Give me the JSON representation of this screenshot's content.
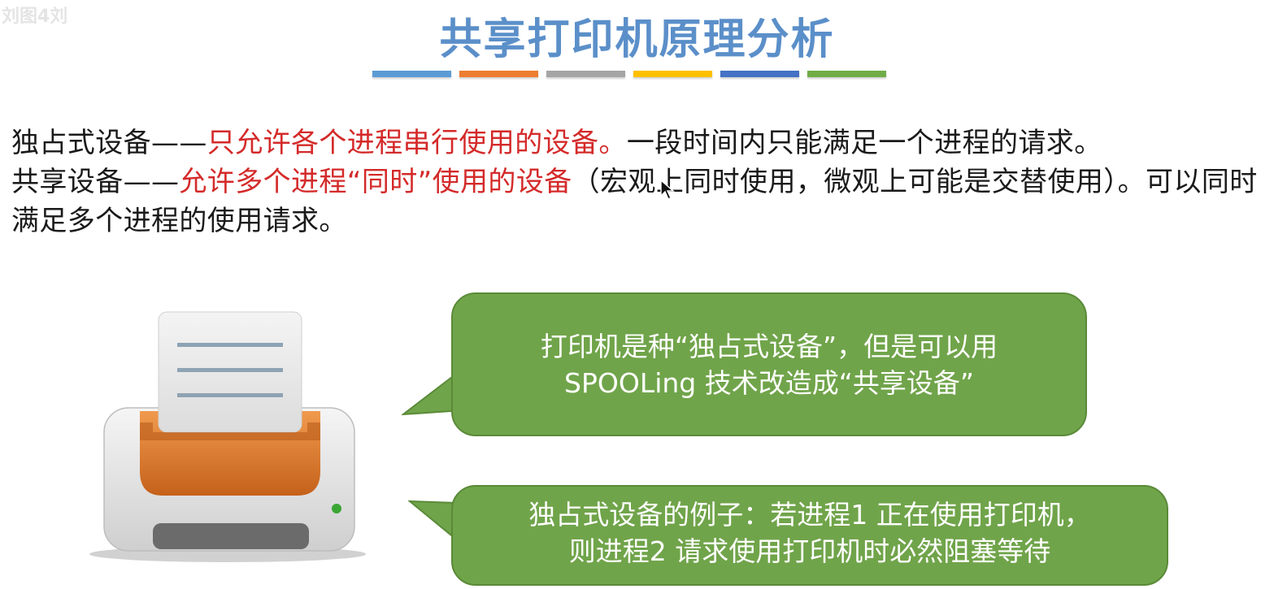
{
  "watermark": "刘图4刘",
  "title": "共享打印机原理分析",
  "color_bars": [
    "#5b9bd5",
    "#ed7d31",
    "#a5a5a5",
    "#ffc000",
    "#4472c4",
    "#70ad47"
  ],
  "paragraph1": {
    "term": "独占式设备——",
    "definition": "只允许各个进程串行使用的设备。",
    "rest": "一段时间内只能满足一个进程的请求。"
  },
  "paragraph2": {
    "term": "共享设备——",
    "definition": "允许多个进程“同时”使用的设备",
    "rest": "（宏观上同时使用，微观上可能是交替使用）。可以同时满足多个进程的使用请求。"
  },
  "callout1": {
    "line1": "打印机是种“独占式设备”，但是可以用",
    "line2": "SPOOLing 技术改造成“共享设备”"
  },
  "callout2": {
    "line1": "独占式设备的例子：若进程1 正在使用打印机，",
    "line2": "则进程2 请求使用打印机时必然阻塞等待"
  },
  "colors": {
    "title": "#5b8fc9",
    "highlight_red": "#d42a2a",
    "callout_green": "#70a44a"
  },
  "icons": [
    "printer-icon",
    "mouse-cursor-icon"
  ]
}
